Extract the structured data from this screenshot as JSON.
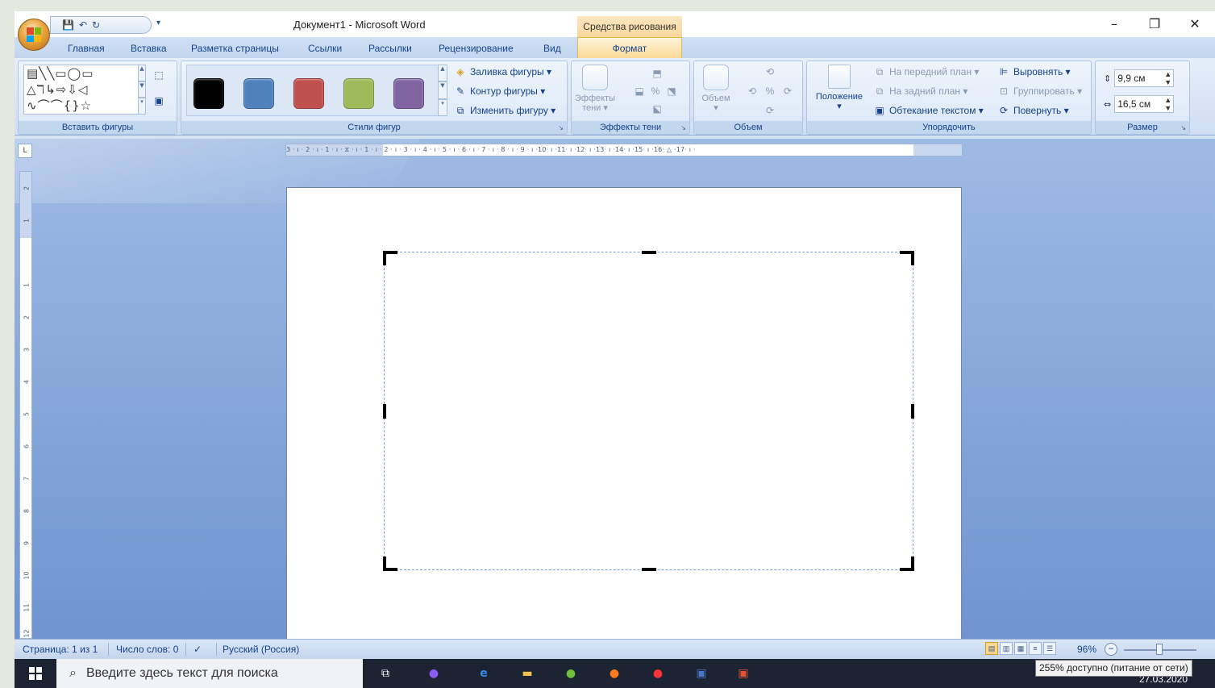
{
  "window": {
    "title": "Документ1 - Microsoft Word",
    "context_tab_title": "Средства рисования",
    "controls": {
      "minimize": "–",
      "restore": "❐",
      "close": "✕"
    },
    "qat_more": "▾"
  },
  "tabs": [
    {
      "label": "Главная"
    },
    {
      "label": "Вставка"
    },
    {
      "label": "Разметка страницы"
    },
    {
      "label": "Ссылки"
    },
    {
      "label": "Рассылки"
    },
    {
      "label": "Рецензирование"
    },
    {
      "label": "Вид"
    },
    {
      "label": "Формат",
      "active": true
    }
  ],
  "ribbon": {
    "insert_shapes": {
      "label": "Вставить фигуры"
    },
    "shape_styles": {
      "label": "Стили фигур",
      "swatches": [
        "#000000",
        "#4f81bd",
        "#c0504d",
        "#9bbb59",
        "#8064a2"
      ],
      "fill": "Заливка фигуры ▾",
      "outline": "Контур фигуры ▾",
      "change": "Изменить фигуру ▾"
    },
    "shadow_effects": {
      "label": "Эффекты тени",
      "button": "Эффекты",
      "button2": "тени ▾"
    },
    "volume": {
      "label": "Объем",
      "button": "Объем"
    },
    "arrange": {
      "label": "Упорядочить",
      "position": "Положение",
      "bring_forward": "На передний план ▾",
      "send_back": "На задний план ▾",
      "wrap": "Обтекание текстом ▾",
      "align": "Выровнять ▾",
      "group": "Группировать ▾",
      "rotate": "Повернуть ▾"
    },
    "size": {
      "label": "Размер",
      "height": "9,9 см",
      "width": "16,5 см"
    }
  },
  "ruler": {
    "corner": "L",
    "horizontal_text": "3 · ı · 2 · ı · 1 · ı · ⧖ · ı · 1 · ı · 2 · ı · 3 · ı · 4 · ı · 5 · ı · 6 · ı · 7 · ı · 8 · ı · 9 · ı ·10· ı ·11· ı ·12· ı ·13· ı ·14· ı ·15· ı ·16· △ ·17· ı ·",
    "vertical_numbers": [
      "2",
      "1",
      "1",
      "2",
      "3",
      "4",
      "5",
      "6",
      "7",
      "8",
      "9",
      "10",
      "11",
      "12"
    ]
  },
  "statusbar": {
    "page": "Страница: 1 из 1",
    "words": "Число слов: 0",
    "language": "Русский (Россия)",
    "zoom": "96%",
    "zoom_level_percent": 96
  },
  "taskbar": {
    "search_placeholder": "Введите здесь текст для поиска",
    "date": "27.03.2020",
    "tooltip": "255% доступно (питание от сети)",
    "icons": [
      "task-view-icon",
      "cortana-icon",
      "edge-icon",
      "file-explorer-icon",
      "utorrent-icon",
      "firefox-icon",
      "yandex-icon",
      "word-icon",
      "powerpoint-icon"
    ]
  }
}
